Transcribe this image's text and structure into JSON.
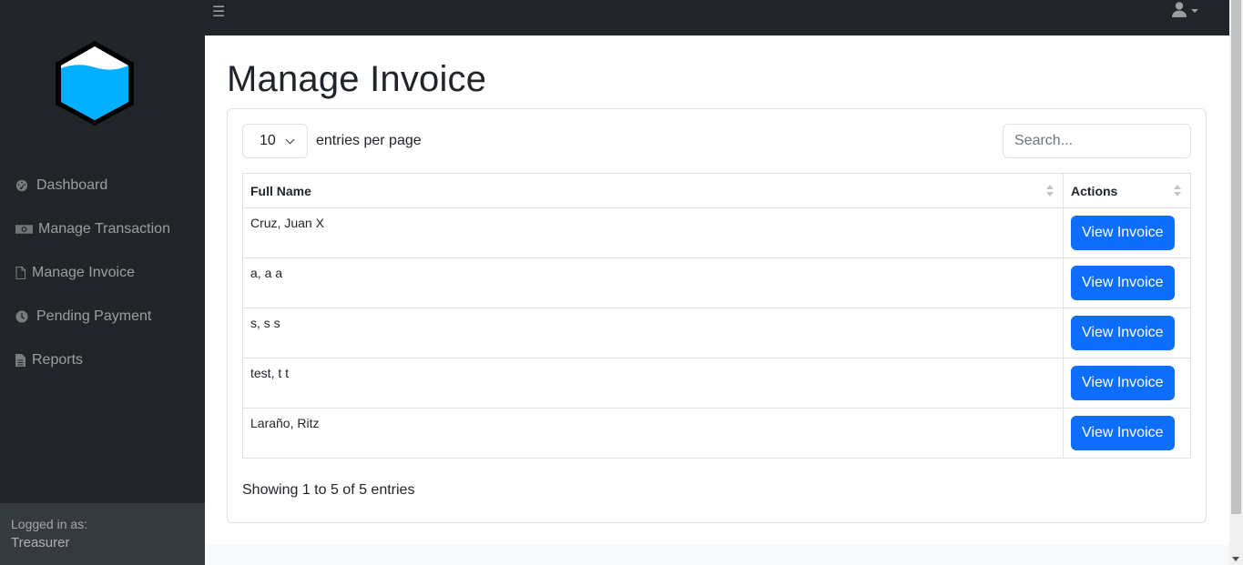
{
  "app": {
    "user_label": "Logged in as:",
    "user_name": "Treasurer"
  },
  "sidebar": {
    "items": [
      {
        "label": "Dashboard",
        "icon": "dashboard-icon"
      },
      {
        "label": "Manage Transaction",
        "icon": "money-bill-icon"
      },
      {
        "label": "Manage Invoice",
        "icon": "file-icon"
      },
      {
        "label": "Pending Payment",
        "icon": "clock-icon"
      },
      {
        "label": "Reports",
        "icon": "file-lines-icon"
      }
    ]
  },
  "topbar": {
    "menu_icon": "hamburger-icon",
    "user_icon": "user-icon"
  },
  "page": {
    "title": "Manage Invoice"
  },
  "table_controls": {
    "per_page_value": "10",
    "per_page_label": "entries per page",
    "search_placeholder": "Search..."
  },
  "table": {
    "columns": [
      "Full Name",
      "Actions"
    ],
    "rows": [
      {
        "name": "Cruz, Juan X",
        "action": "View Invoice"
      },
      {
        "name": "a, a a",
        "action": "View Invoice"
      },
      {
        "name": "s, s s",
        "action": "View Invoice"
      },
      {
        "name": "test, t t",
        "action": "View Invoice"
      },
      {
        "name": "Laraño, Ritz",
        "action": "View Invoice"
      }
    ]
  },
  "footer_info": "Showing 1 to 5 of 5 entries",
  "colors": {
    "sidebar": "#212529",
    "primary": "#0d6efd",
    "logo_fill": "#00b0ff"
  }
}
